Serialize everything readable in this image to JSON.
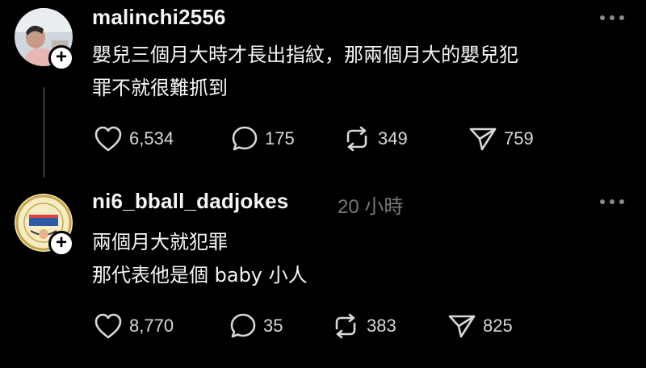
{
  "colors": {
    "background": "#000000",
    "text_primary": "#f3f5f7",
    "text_secondary": "#777777",
    "icon": "#d8d8d8"
  },
  "posts": [
    {
      "username": "malinchi2556",
      "timestamp": "",
      "lines": [
        "嬰兒三個月大時才長出指紋，那兩個月大的嬰兒犯",
        "罪不就很難抓到"
      ],
      "likes": "6,534",
      "replies": "175",
      "reposts": "349",
      "shares": "759",
      "icons": [
        "heart-icon",
        "comment-icon",
        "repost-icon",
        "share-icon",
        "more-icon",
        "plus-icon"
      ]
    },
    {
      "username": "ni6_bball_dadjokes",
      "timestamp": "20 小時",
      "lines": [
        "兩個月大就犯罪",
        "那代表他是個 baby 小人"
      ],
      "likes": "8,770",
      "replies": "35",
      "reposts": "383",
      "shares": "825",
      "icons": [
        "heart-icon",
        "comment-icon",
        "repost-icon",
        "share-icon",
        "more-icon",
        "plus-icon"
      ]
    }
  ]
}
